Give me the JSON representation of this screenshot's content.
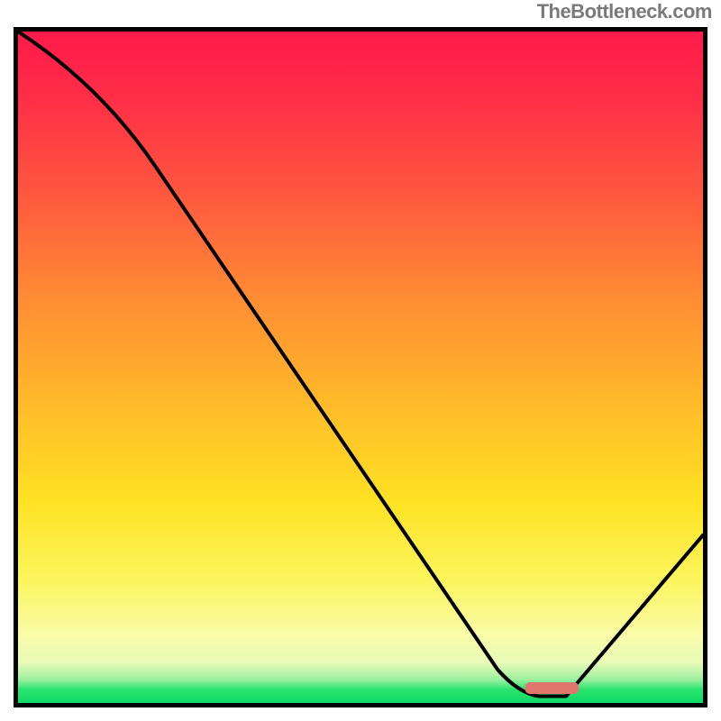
{
  "attribution": "TheBottleneck.com",
  "chart_data": {
    "type": "line",
    "title": "",
    "xlabel": "",
    "ylabel": "",
    "xlim": [
      0,
      100
    ],
    "ylim": [
      0,
      100
    ],
    "series": [
      {
        "name": "bottleneck-curve",
        "x": [
          0,
          20,
          70,
          76,
          80,
          100
        ],
        "values": [
          100,
          80,
          5,
          1,
          1,
          25
        ]
      }
    ],
    "annotations": [
      {
        "name": "optimal-marker",
        "x_range": [
          74,
          82
        ],
        "y": 1
      }
    ],
    "gradient_stops": [
      {
        "pct": 0,
        "color": "#ff1a4a"
      },
      {
        "pct": 40,
        "color": "#ff8d33"
      },
      {
        "pct": 70,
        "color": "#ffe223"
      },
      {
        "pct": 90,
        "color": "#f9fca9"
      },
      {
        "pct": 98,
        "color": "#29e46f"
      },
      {
        "pct": 100,
        "color": "#0fd967"
      }
    ]
  }
}
